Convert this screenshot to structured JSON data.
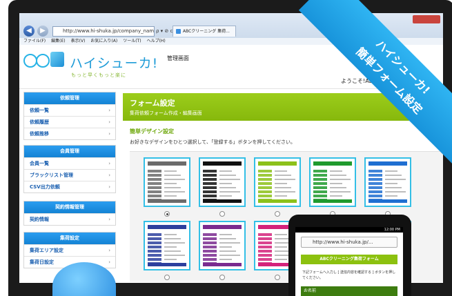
{
  "browser": {
    "address": "http://www.hi-shuka.jp/company_name/",
    "address_tools": "ρ ▾ ⊘ c ✕",
    "tab_title": "ABCクリーニング 集荷...",
    "menu": [
      "ファイル(F)",
      "編集(E)",
      "表示(V)",
      "お気に入り(A)",
      "ツール(T)",
      "ヘルプ(H)"
    ]
  },
  "header": {
    "logo_text": "ハイシューカ!",
    "tagline": "もっと早くもっと楽に",
    "admin_title": "管理画面",
    "welcome": "ようこそ!ABC"
  },
  "sidebar": [
    {
      "title": "依頼管理",
      "items": [
        "依頼一覧",
        "依頼履歴",
        "依頼推移"
      ]
    },
    {
      "title": "会員管理",
      "items": [
        "会員一覧",
        "ブラックリスト管理",
        "CSV出力依頼"
      ]
    },
    {
      "title": "契約情報管理",
      "items": [
        "契約情報"
      ]
    },
    {
      "title": "集荷設定",
      "items": [
        "集荷エリア設定",
        "集荷日設定"
      ]
    }
  ],
  "main": {
    "title": "フォーム設定",
    "subtitle": "集荷依頼フォーム作成・編集画面",
    "section_title": "簡単デザイン設定",
    "description": "お好きなデザインをひとつ選択して、「登録する」ボタンを押してください。"
  },
  "designs": [
    {
      "color": "#6b6b6b",
      "selected": true
    },
    {
      "color": "#111111",
      "selected": false
    },
    {
      "color": "#8cc11a",
      "selected": false
    },
    {
      "color": "#1f9a2d",
      "selected": false
    },
    {
      "color": "#1f6fd1",
      "selected": false
    },
    {
      "color": "#2d3f9e",
      "selected": false
    },
    {
      "color": "#7a2a8f",
      "selected": false
    },
    {
      "color": "#d4237b",
      "selected": false
    },
    {
      "color": "#e08a1a",
      "selected": false
    },
    {
      "color": "#2bb3c8",
      "selected": false
    }
  ],
  "ribbon": {
    "line1": "ハイシューカ!",
    "line2": "簡単フォーム設定"
  },
  "phone": {
    "status_time": "12:00 PM",
    "url": "http://www.hi-shuka.jp/...",
    "form_title": "ABCクリーニング集荷フォーム",
    "text": "下記フォームへ入力し [ 送信内容を確認する ] ボタンを押してください。",
    "field_label": "お名前"
  }
}
